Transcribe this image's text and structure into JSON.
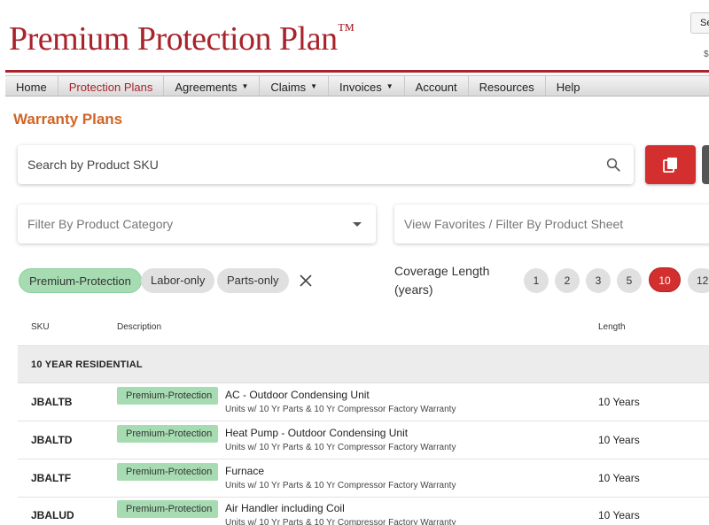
{
  "header": {
    "brand": "Premium Protection Plan",
    "brand_mark": "™",
    "top_button": "Se",
    "top_small": "$"
  },
  "nav": {
    "items": [
      {
        "label": "Home",
        "active": false,
        "dropdown": false
      },
      {
        "label": "Protection Plans",
        "active": true,
        "dropdown": false
      },
      {
        "label": "Agreements",
        "active": false,
        "dropdown": true
      },
      {
        "label": "Claims",
        "active": false,
        "dropdown": true
      },
      {
        "label": "Invoices",
        "active": false,
        "dropdown": true
      },
      {
        "label": "Account",
        "active": false,
        "dropdown": false
      },
      {
        "label": "Resources",
        "active": false,
        "dropdown": false
      },
      {
        "label": "Help",
        "active": false,
        "dropdown": false
      }
    ]
  },
  "page": {
    "title": "Warranty Plans"
  },
  "search": {
    "placeholder": "Search by Product SKU",
    "value": ""
  },
  "filters": {
    "category_placeholder": "Filter By Product Category",
    "favorites_placeholder": "View Favorites / Filter By Product Sheet"
  },
  "chips": [
    {
      "label": "Premium-Protection",
      "selected": true
    },
    {
      "label": "Labor-only",
      "selected": false
    },
    {
      "label": "Parts-only",
      "selected": false
    }
  ],
  "coverage": {
    "label": "Coverage Length (years)",
    "options": [
      "1",
      "2",
      "3",
      "5",
      "10",
      "12"
    ],
    "selected": "10"
  },
  "table": {
    "headers": {
      "sku": "SKU",
      "description": "Description",
      "length": "Length"
    },
    "group": "10 YEAR RESIDENTIAL",
    "rows": [
      {
        "sku": "JBALTB",
        "badge": "Premium-Protection",
        "title": "AC - Outdoor Condensing Unit",
        "subtitle": "Units w/ 10 Yr Parts & 10 Yr Compressor Factory Warranty",
        "length": "10 Years"
      },
      {
        "sku": "JBALTD",
        "badge": "Premium-Protection",
        "title": "Heat Pump - Outdoor Condensing Unit",
        "subtitle": "Units w/ 10 Yr Parts & 10 Yr Compressor Factory Warranty",
        "length": "10 Years"
      },
      {
        "sku": "JBALTF",
        "badge": "Premium-Protection",
        "title": "Furnace",
        "subtitle": "Units w/ 10 Yr Parts & 10 Yr Compressor Factory Warranty",
        "length": "10 Years"
      },
      {
        "sku": "JBALUD",
        "badge": "Premium-Protection",
        "title": "Air Handler including Coil",
        "subtitle": "Units w/ 10 Yr Parts & 10 Yr Compressor Factory Warranty",
        "length": "10 Years"
      }
    ]
  },
  "colors": {
    "brand_red": "#a8232b",
    "title_orange": "#d16424",
    "accent_red": "#d32f2f",
    "badge_green": "#a7dcb3"
  }
}
